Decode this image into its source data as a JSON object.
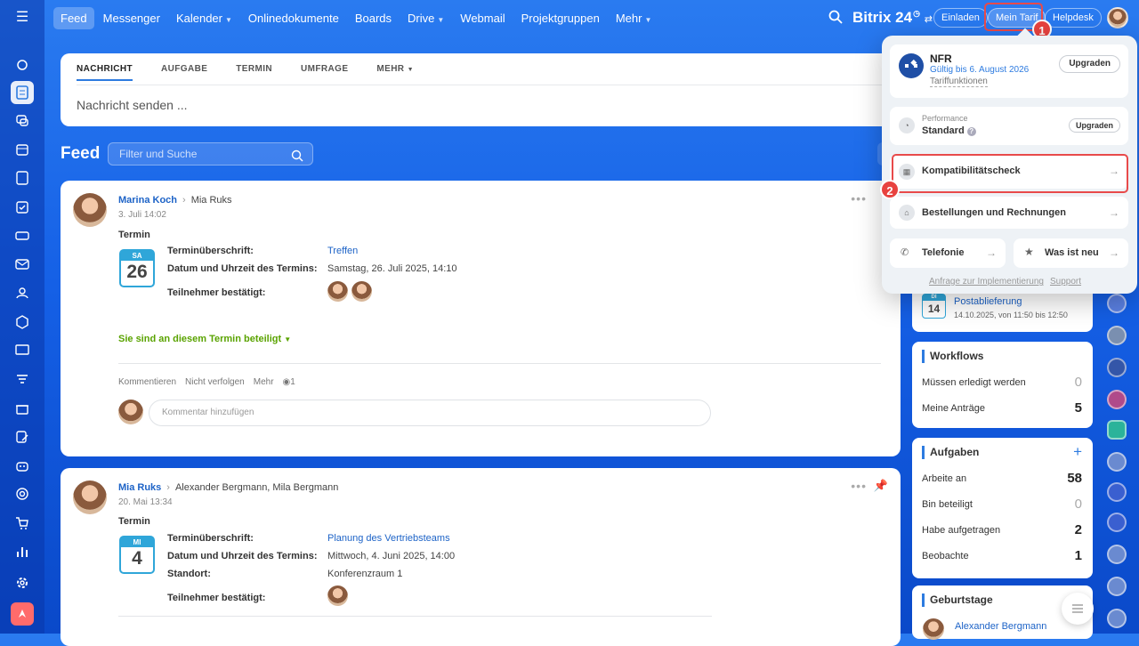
{
  "topnav": [
    "Feed",
    "Messenger",
    "Kalender",
    "Onlinedokumente",
    "Boards",
    "Drive",
    "Webmail",
    "Projektgruppen",
    "Mehr"
  ],
  "header": {
    "brand": "Bitrix 24",
    "invite": "Einladen",
    "plan": "Mein Tarif",
    "helpdesk": "Helpdesk"
  },
  "composer": {
    "tabs": [
      "NACHRICHT",
      "AUFGABE",
      "TERMIN",
      "UMFRAGE",
      "MEHR"
    ],
    "placeholder": "Nachricht senden ..."
  },
  "feed": {
    "title": "Feed",
    "search_placeholder": "Filter und Suche"
  },
  "posts": [
    {
      "author": "Marina Koch",
      "to": "Mia Ruks",
      "date": "3. Juli 14:02",
      "kind": "Termin",
      "cal_day": "SA",
      "cal_num": "26",
      "fields": [
        {
          "label": "Terminüberschrift:",
          "value": "Treffen"
        },
        {
          "label": "Datum und Uhrzeit des Termins:",
          "value": "Samstag, 26. Juli 2025, 14:10"
        },
        {
          "label": "Teilnehmer bestätigt:",
          "value": ""
        }
      ],
      "status": "Sie sind an diesem Termin beteiligt",
      "actions": [
        "Kommentieren",
        "Nicht verfolgen",
        "Mehr"
      ],
      "views": "1",
      "comment_placeholder": "Kommentar hinzufügen"
    },
    {
      "author": "Mia Ruks",
      "to": "Alexander Bergmann, Mila Bergmann",
      "date": "20. Mai 13:34",
      "kind": "Termin",
      "cal_day": "MI",
      "cal_num": "4",
      "fields": [
        {
          "label": "Terminüberschrift:",
          "value": "Planung des Vertriebsteams"
        },
        {
          "label": "Datum und Uhrzeit des Termins:",
          "value": "Mittwoch, 4. Juni 2025, 14:00"
        },
        {
          "label": "Standort:",
          "value": "Konferenzraum 1"
        },
        {
          "label": "Teilnehmer bestätigt:",
          "value": ""
        }
      ]
    }
  ],
  "right": {
    "event": {
      "day": "DI",
      "num": "14",
      "title": "Postablieferung",
      "time": "14.10.2025, von 11:50 bis 12:50"
    },
    "workflows": {
      "title": "Workflows",
      "rows": [
        {
          "label": "Müssen erledigt werden",
          "n": "0"
        },
        {
          "label": "Meine Anträge",
          "n": "5"
        }
      ]
    },
    "tasks": {
      "title": "Aufgaben",
      "rows": [
        {
          "label": "Arbeite an",
          "n": "58"
        },
        {
          "label": "Bin beteiligt",
          "n": "0"
        },
        {
          "label": "Habe aufgetragen",
          "n": "2"
        },
        {
          "label": "Beobachte",
          "n": "1"
        }
      ]
    },
    "birthdays": {
      "title": "Geburtstage",
      "person": "Alexander Bergmann"
    }
  },
  "popup": {
    "plan": "NFR",
    "valid": "Gültig bis 6. August 2026",
    "features": "Tariffunktionen",
    "upgrade": "Upgraden",
    "perf_label": "Performance",
    "perf_value": "Standard",
    "perf_upgrade": "Upgraden",
    "compat": "Kompatibilitätscheck",
    "orders": "Bestellungen und Rechnungen",
    "telephony": "Telefonie",
    "whatsnew": "Was ist neu",
    "impl": "Anfrage zur Implementierung",
    "support": "Support"
  },
  "badges": [
    "1",
    "2"
  ],
  "colors": {
    "accent": "#2d7be0",
    "highlight": "#e84a4a",
    "green": "#5aa300"
  }
}
